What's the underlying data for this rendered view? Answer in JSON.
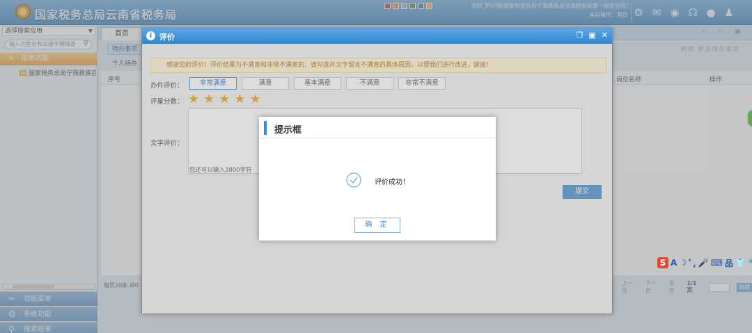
{
  "header": {
    "title": "国家税务总局云南省税务局",
    "welcome_line1": "您好,罗兴国[国家税务总局宁蒗彝族自治县税务局第一税务分局]",
    "welcome_line2": "当前操作：首页",
    "swatches": [
      "#e24b4b",
      "#e89a3c",
      "#a7b8c9",
      "#4cae4c",
      "#5a88c8",
      "#e6c44a"
    ]
  },
  "sidebar": {
    "app_select": "选择搜索应用",
    "search_placeholder": "输入功能名称关键字模糊查",
    "common_func": "常用功能",
    "tree_item": "国家税务总局宁蒗彝族自治",
    "nav": [
      "功能菜单",
      "系统功能",
      "搜索结果"
    ]
  },
  "main": {
    "tab_home": "首页",
    "subtab": "待办事项",
    "panel_title": "个人待办",
    "toplinks": "刷新   更多待办事项",
    "col_seq": "序号",
    "col_post": "岗位名称",
    "col_op": "操作",
    "pager_left": "每页20条 共0",
    "pager_prev": "上一页",
    "pager_next": "下一页",
    "pager_last": "末页",
    "pager_count": "1/1页",
    "pager_go": "跳转"
  },
  "eval": {
    "title": "评价",
    "notice": "感谢您的评价！评价结果为不满意和非常不满意的，请勾选并文字留言不满意的具体原因，以便我们进行改进，谢谢！",
    "label_rating": "办件评价：",
    "options": [
      "非常满意",
      "满意",
      "基本满意",
      "不满意",
      "非常不满意"
    ],
    "selected": 0,
    "label_score": "评星分数：",
    "stars": 5,
    "label_text": "文字评价：",
    "remaining": "您还可以输入3800字符",
    "submit": "提交"
  },
  "prompt": {
    "title": "提示框",
    "message": "评价成功！",
    "ok": "确 定"
  },
  "ime": [
    "A",
    "☽",
    "ﾟ,",
    "🎤",
    "⌨",
    "品",
    "👕",
    "🔧"
  ]
}
